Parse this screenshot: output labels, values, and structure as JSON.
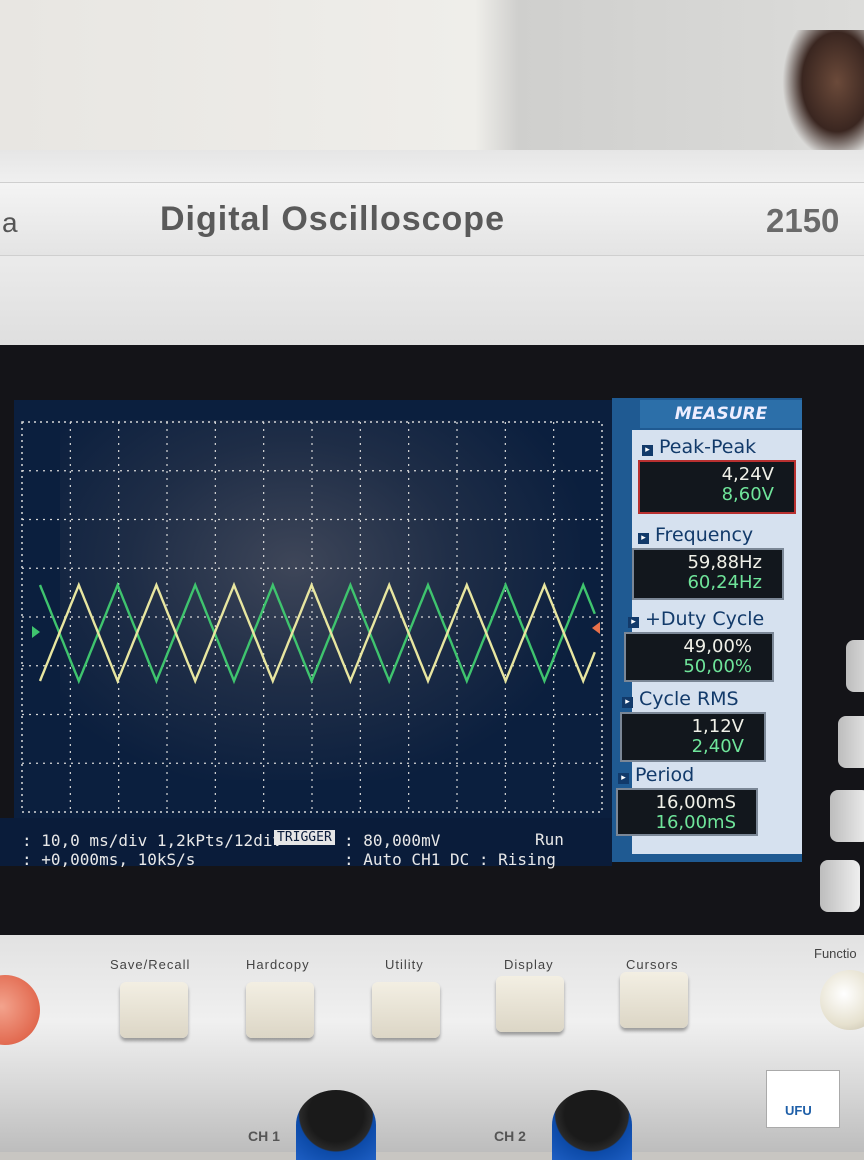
{
  "device": {
    "brand_fragment": "a",
    "title": "Digital Oscilloscope",
    "model_fragment": "2150"
  },
  "status_bar": {
    "line1": ": 10,0 ms/div 1,2kPts/12div",
    "line2": ": +0,000ms, 10kS/s",
    "trigger_label": "TRIGGER",
    "trigger_line1": ": 80,000mV",
    "trigger_line2": ": Auto CH1 DC : Rising",
    "run_state": "Run"
  },
  "measure_panel": {
    "header": "MEASURE",
    "items": [
      {
        "label": "Peak-Peak",
        "ch1": "4,24V",
        "ch2": "8,60V",
        "selected": true
      },
      {
        "label": "Frequency",
        "ch1": "59,88Hz",
        "ch2": "60,24Hz",
        "selected": false
      },
      {
        "label": "+Duty Cycle",
        "ch1": "49,00%",
        "ch2": "50,00%",
        "selected": false
      },
      {
        "label": "Cycle RMS",
        "ch1": "1,12V",
        "ch2": "2,40V",
        "selected": false
      },
      {
        "label": "Period",
        "ch1": "16,00mS",
        "ch2": "16,00mS",
        "selected": false
      }
    ]
  },
  "front_panel_buttons": [
    "Save/Recall",
    "Hardcopy",
    "Utility",
    "Display",
    "Cursors"
  ],
  "function_label": "Functio",
  "channel_labels": [
    "CH 1",
    "CH 2"
  ],
  "logo_text": "UFU",
  "trace_colors": {
    "ch1": "#e8e6a0",
    "ch2": "#3fc46e",
    "grid": "#d8d8d8"
  }
}
